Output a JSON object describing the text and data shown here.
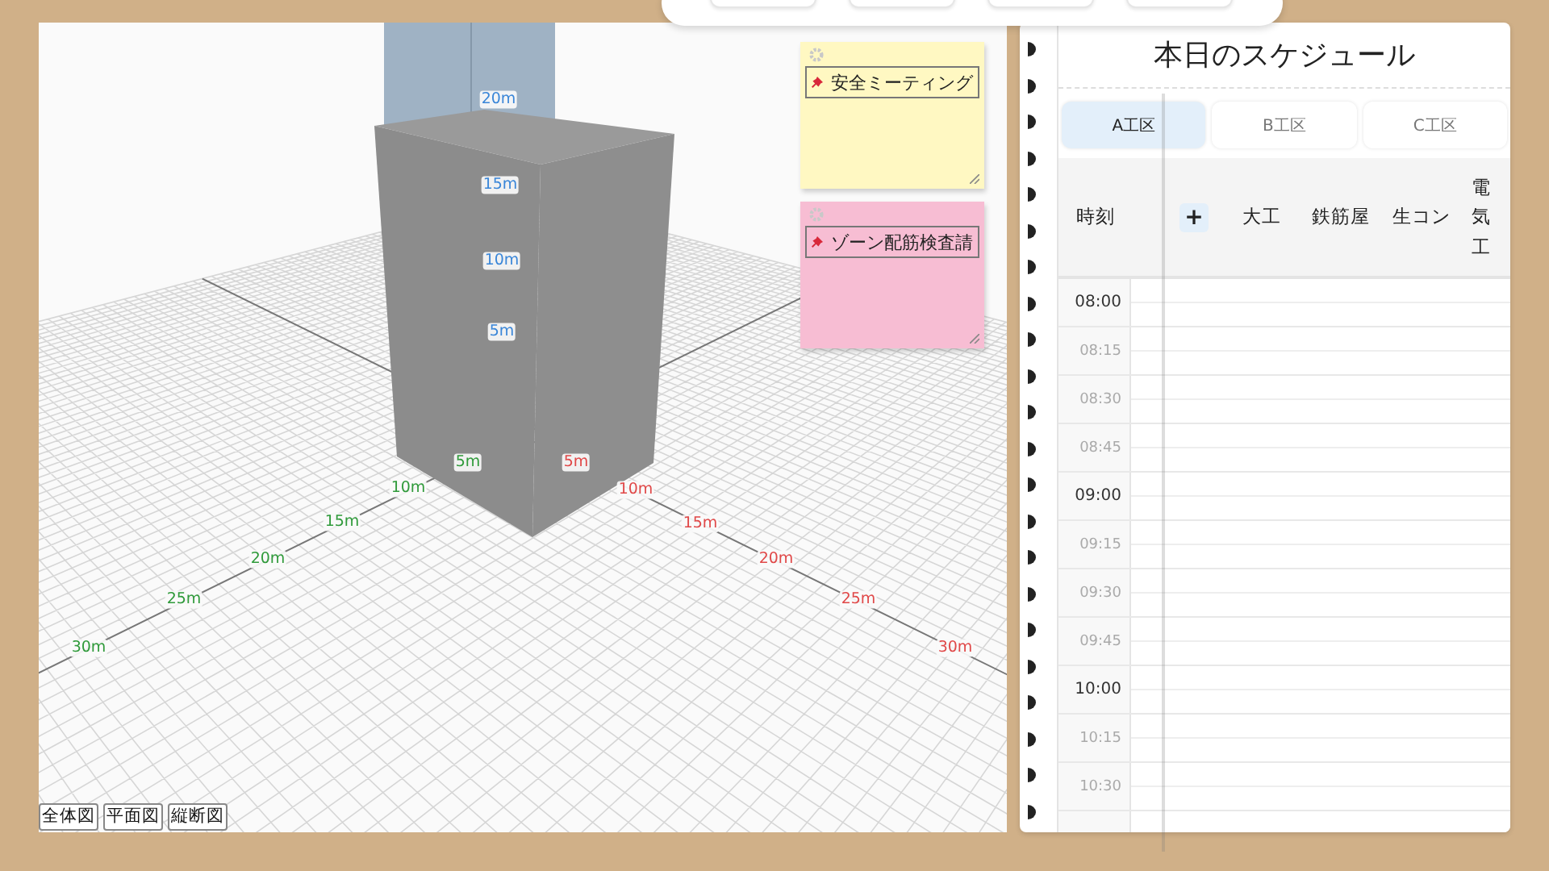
{
  "scene": {
    "axes": [
      {
        "color": "#2f9a3a",
        "labels": [
          "5m",
          "10m",
          "15m",
          "20m",
          "25m",
          "30m"
        ]
      },
      {
        "color": "#e04848",
        "labels": [
          "5m",
          "10m",
          "15m",
          "20m",
          "25m",
          "30m"
        ]
      },
      {
        "color": "#3a86d8",
        "labels": [
          "20m",
          "15m",
          "10m",
          "5m"
        ]
      }
    ],
    "sticky_notes": [
      {
        "title": "安全ミーティング",
        "color": "#fff8c2"
      },
      {
        "title": "ゾーン配筋検査請",
        "color": "#f7bdd3"
      }
    ],
    "view_buttons": [
      "全体図",
      "平面図",
      "縦断図"
    ]
  },
  "schedule": {
    "title": "本日のスケジュール",
    "tabs": [
      {
        "label": "A工区",
        "selected": true
      },
      {
        "label": "B工区",
        "selected": false
      },
      {
        "label": "C工区",
        "selected": false
      }
    ],
    "time_header": "時刻",
    "add_button": "+",
    "trades": [
      "大工",
      "鉄筋屋",
      "生コン",
      "電気工"
    ],
    "rows": [
      {
        "time": "08:00",
        "kind": "hour"
      },
      {
        "time": "08:15",
        "kind": "quarter"
      },
      {
        "time": "08:30",
        "kind": "quarter"
      },
      {
        "time": "08:45",
        "kind": "quarter"
      },
      {
        "time": "09:00",
        "kind": "hour"
      },
      {
        "time": "09:15",
        "kind": "quarter"
      },
      {
        "time": "09:30",
        "kind": "quarter"
      },
      {
        "time": "09:45",
        "kind": "quarter"
      },
      {
        "time": "10:00",
        "kind": "hour"
      },
      {
        "time": "10:15",
        "kind": "quarter"
      },
      {
        "time": "10:30",
        "kind": "quarter"
      }
    ]
  }
}
